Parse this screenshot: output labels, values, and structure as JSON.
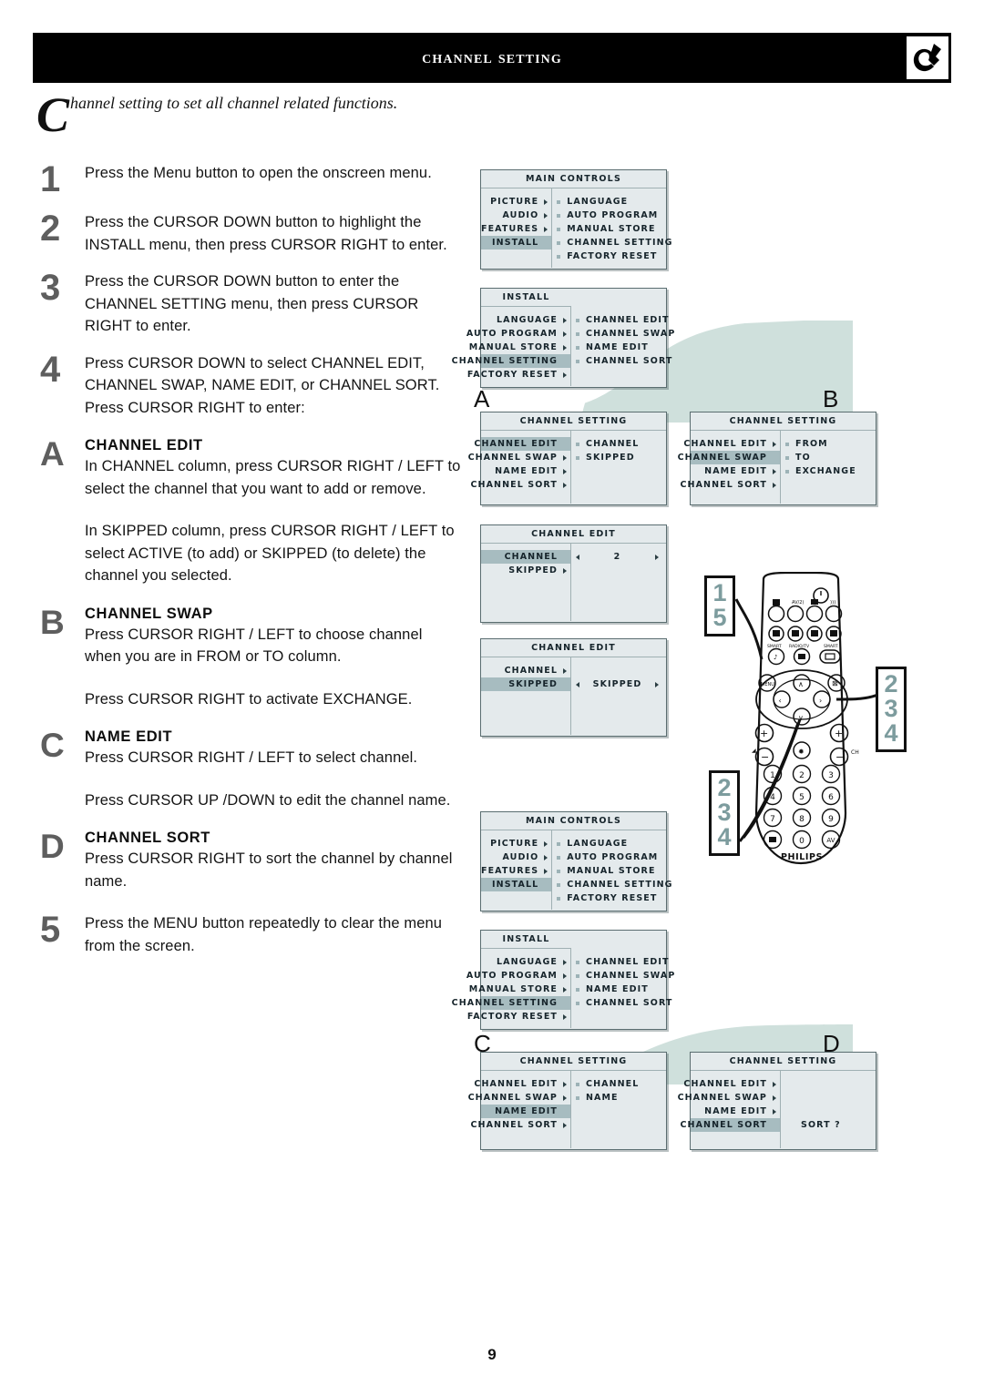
{
  "header": {
    "title": "Channel Setting",
    "logo_icon": "philips-shield-icon"
  },
  "intro": {
    "dropcap": "C",
    "text": "hannel setting to set all channel related functions."
  },
  "steps": [
    {
      "num": "1",
      "paragraphs": [
        "Press the Menu button to open the onscreen menu."
      ]
    },
    {
      "num": "2",
      "paragraphs": [
        "Press the CURSOR DOWN button to highlight the INSTALL menu, then press CURSOR RIGHT to enter."
      ]
    },
    {
      "num": "3",
      "paragraphs": [
        "Press the CURSOR DOWN button to enter the CHANNEL SETTING menu, then press CURSOR RIGHT to enter."
      ]
    },
    {
      "num": "4",
      "paragraphs": [
        "Press CURSOR DOWN to select CHANNEL EDIT, CHANNEL SWAP, NAME EDIT, or CHANNEL SORT. Press CURSOR RIGHT to enter:"
      ]
    },
    {
      "num": "A",
      "heading": "CHANNEL EDIT",
      "paragraphs": [
        "In CHANNEL column, press CURSOR RIGHT / LEFT to select the channel that you want to add or remove.",
        "In SKIPPED column, press CURSOR RIGHT / LEFT to select ACTIVE (to add) or SKIPPED (to delete) the channel you selected."
      ]
    },
    {
      "num": "B",
      "heading": "CHANNEL SWAP",
      "paragraphs": [
        "Press CURSOR RIGHT / LEFT to choose channel when you are in FROM or TO column.",
        "Press CURSOR RIGHT to activate EXCHANGE."
      ]
    },
    {
      "num": "C",
      "heading": "NAME EDIT",
      "paragraphs": [
        "Press CURSOR RIGHT / LEFT to select channel.",
        "Press CURSOR UP /DOWN to edit the channel name."
      ]
    },
    {
      "num": "D",
      "heading": "CHANNEL SORT",
      "paragraphs": [
        "Press CURSOR RIGHT to sort the channel by channel name."
      ]
    },
    {
      "num": "5",
      "paragraphs": [
        "Press the MENU button repeatedly to clear the menu from the screen."
      ]
    }
  ],
  "osd": {
    "main_controls_top": {
      "title": "MAIN CONTROLS",
      "title_align": "center",
      "left": [
        {
          "label": "PICTURE",
          "arrow": true,
          "highlight": false
        },
        {
          "label": "AUDIO",
          "arrow": true,
          "highlight": false
        },
        {
          "label": "FEATURES",
          "arrow": true,
          "highlight": false
        },
        {
          "label": "INSTALL",
          "arrow": false,
          "highlight": true
        }
      ],
      "right": [
        "LANGUAGE",
        "AUTO PROGRAM",
        "MANUAL STORE",
        "CHANNEL SETTING",
        "FACTORY RESET"
      ]
    },
    "install_top": {
      "title": "INSTALL",
      "title_align": "left-col",
      "left": [
        {
          "label": "LANGUAGE",
          "arrow": true,
          "highlight": false
        },
        {
          "label": "AUTO PROGRAM",
          "arrow": true,
          "highlight": false
        },
        {
          "label": "MANUAL STORE",
          "arrow": true,
          "highlight": false
        },
        {
          "label": "CHANNEL SETTING",
          "arrow": false,
          "highlight": true
        },
        {
          "label": "FACTORY RESET",
          "arrow": true,
          "highlight": false
        }
      ],
      "right": [
        "CHANNEL EDIT",
        "CHANNEL SWAP",
        "NAME EDIT",
        "CHANNEL SORT"
      ]
    },
    "panel_a": {
      "letter": "A",
      "title": "CHANNEL SETTING",
      "left": [
        {
          "label": "CHANNEL EDIT",
          "arrow": false,
          "highlight": true
        },
        {
          "label": "CHANNEL SWAP",
          "arrow": true,
          "highlight": false
        },
        {
          "label": "NAME EDIT",
          "arrow": true,
          "highlight": false
        },
        {
          "label": "CHANNEL SORT",
          "arrow": true,
          "highlight": false
        }
      ],
      "right": [
        "CHANNEL",
        "SKIPPED"
      ]
    },
    "panel_b": {
      "letter": "B",
      "title": "CHANNEL SETTING",
      "left": [
        {
          "label": "CHANNEL EDIT",
          "arrow": true,
          "highlight": false
        },
        {
          "label": "CHANNEL SWAP",
          "arrow": false,
          "highlight": true
        },
        {
          "label": "NAME EDIT",
          "arrow": true,
          "highlight": false
        },
        {
          "label": "CHANNEL SORT",
          "arrow": true,
          "highlight": false
        }
      ],
      "right": [
        "FROM",
        "TO",
        "EXCHANGE"
      ]
    },
    "channel_edit_1": {
      "title": "CHANNEL EDIT",
      "left": [
        {
          "label": "CHANNEL",
          "arrow": false,
          "highlight": true
        },
        {
          "label": "SKIPPED",
          "arrow": true,
          "highlight": false
        }
      ],
      "value_row_index": 0,
      "value": "2"
    },
    "channel_edit_2": {
      "title": "CHANNEL EDIT",
      "left": [
        {
          "label": "CHANNEL",
          "arrow": true,
          "highlight": false
        },
        {
          "label": "SKIPPED",
          "arrow": false,
          "highlight": true
        }
      ],
      "value_row_index": 1,
      "value": "SKIPPED"
    },
    "main_controls_bottom": {
      "title": "MAIN CONTROLS",
      "left": [
        {
          "label": "PICTURE",
          "arrow": true,
          "highlight": false
        },
        {
          "label": "AUDIO",
          "arrow": true,
          "highlight": false
        },
        {
          "label": "FEATURES",
          "arrow": true,
          "highlight": false
        },
        {
          "label": "INSTALL",
          "arrow": false,
          "highlight": true
        }
      ],
      "right": [
        "LANGUAGE",
        "AUTO PROGRAM",
        "MANUAL STORE",
        "CHANNEL SETTING",
        "FACTORY RESET"
      ]
    },
    "install_bottom": {
      "title": "INSTALL",
      "left": [
        {
          "label": "LANGUAGE",
          "arrow": true,
          "highlight": false
        },
        {
          "label": "AUTO PROGRAM",
          "arrow": true,
          "highlight": false
        },
        {
          "label": "MANUAL STORE",
          "arrow": true,
          "highlight": false
        },
        {
          "label": "CHANNEL SETTING",
          "arrow": false,
          "highlight": true
        },
        {
          "label": "FACTORY RESET",
          "arrow": true,
          "highlight": false
        }
      ],
      "right": [
        "CHANNEL EDIT",
        "CHANNEL SWAP",
        "NAME EDIT",
        "CHANNEL SORT"
      ]
    },
    "panel_c": {
      "letter": "C",
      "title": "CHANNEL SETTING",
      "left": [
        {
          "label": "CHANNEL EDIT",
          "arrow": true,
          "highlight": false
        },
        {
          "label": "CHANNEL SWAP",
          "arrow": true,
          "highlight": false
        },
        {
          "label": "NAME EDIT",
          "arrow": false,
          "highlight": true
        },
        {
          "label": "CHANNEL SORT",
          "arrow": true,
          "highlight": false
        }
      ],
      "right": [
        "CHANNEL",
        "NAME"
      ]
    },
    "panel_d": {
      "letter": "D",
      "title": "CHANNEL SETTING",
      "left": [
        {
          "label": "CHANNEL EDIT",
          "arrow": true,
          "highlight": false
        },
        {
          "label": "CHANNEL SWAP",
          "arrow": true,
          "highlight": false
        },
        {
          "label": "NAME EDIT",
          "arrow": true,
          "highlight": false
        },
        {
          "label": "CHANNEL SORT",
          "arrow": false,
          "highlight": true
        }
      ],
      "plain_value": "SORT ?"
    }
  },
  "remote": {
    "brand": "PHILIPS",
    "callouts": [
      {
        "id": "callout-top-left",
        "lines": [
          "1",
          "5"
        ]
      },
      {
        "id": "callout-right",
        "lines": [
          "2",
          "3",
          "4"
        ]
      },
      {
        "id": "callout-bottom-left",
        "lines": [
          "2",
          "3",
          "4"
        ]
      }
    ],
    "keypad": [
      "1",
      "2",
      "3",
      "4",
      "5",
      "6",
      "7",
      "8",
      "9",
      "0"
    ],
    "av_key": "AV",
    "labels": {
      "smart_left": "SMART",
      "radio_tv": "RADIO/TV",
      "smart_right": "SMART",
      "av_top": "AV/2)",
      "ok": "OK",
      "menu": "MENU"
    }
  },
  "page_number": "9",
  "colors": {
    "header_bg": "#000000",
    "osd_bg": "#e4eaec",
    "osd_border": "#5a6d70",
    "osd_highlight": "#a7bcc0",
    "blob_teal": "#cfe0dc",
    "callout_number": "#7d9c9e",
    "step_number": "#5e5e5e"
  }
}
